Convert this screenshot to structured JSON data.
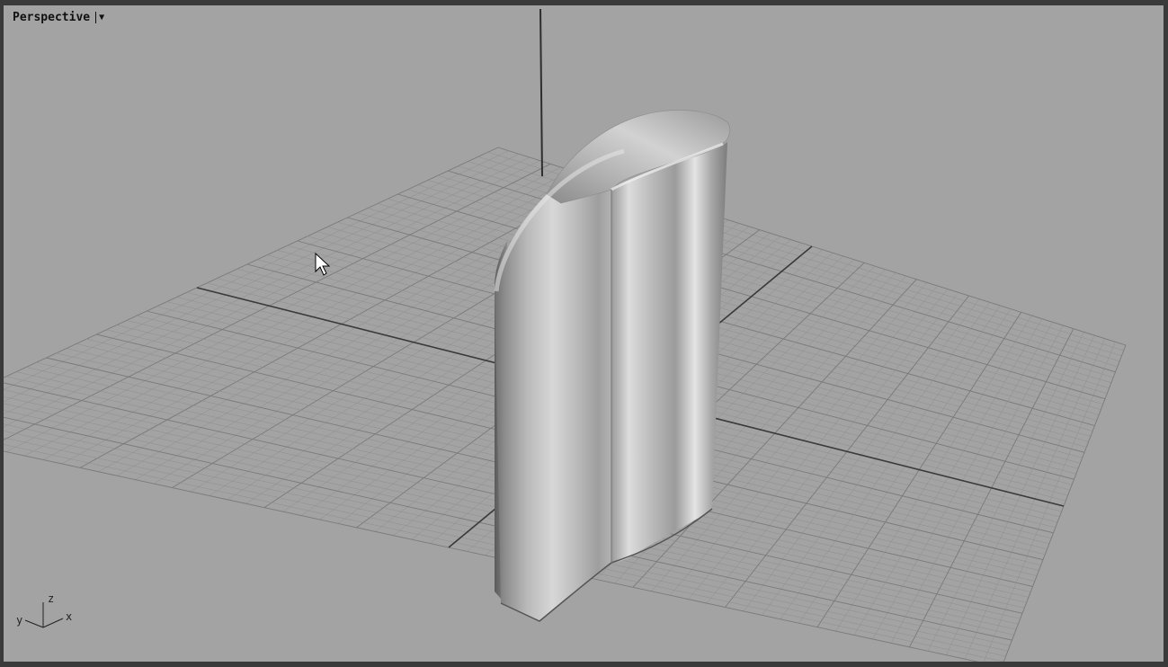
{
  "viewport": {
    "title": "Perspective",
    "menu_icon": "dropdown-triangle-icon"
  },
  "axis_gizmo": {
    "x_label": "x",
    "y_label": "y",
    "z_label": "z"
  },
  "colors": {
    "viewport_background": "#a3a3a3",
    "grid_line": "#8e8e8e",
    "grid_major_line": "#7a7a7a",
    "world_axis": "#3a3a3a",
    "frame": "#3a3a3a"
  },
  "cursor": {
    "icon": "mouse-pointer-icon"
  }
}
